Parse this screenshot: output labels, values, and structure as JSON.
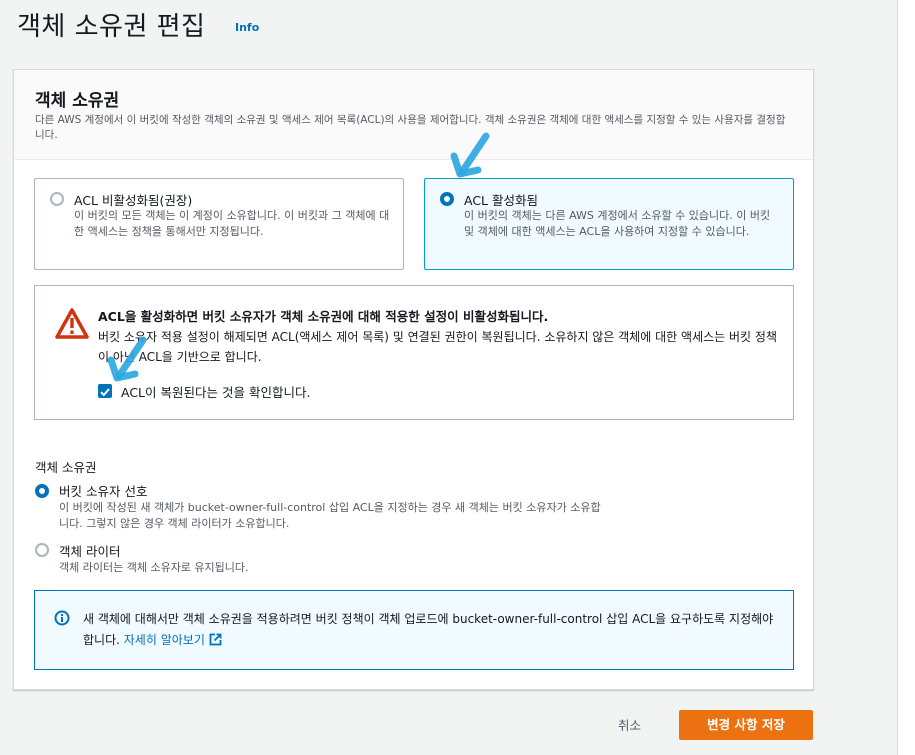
{
  "page": {
    "title": "객체 소유권 편집",
    "info_link": "Info"
  },
  "panel": {
    "title": "객체 소유권",
    "description": "다른 AWS 계정에서 이 버킷에 작성한 객체의 소유권 및 액세스 제어 목록(ACL)의 사용을 제어합니다. 객체 소유권은 객체에 대한 액세스를 지정할 수 있는 사용자를 결정합니다."
  },
  "tiles": [
    {
      "label": "ACL 비활성화됨(권장)",
      "description": "이 버킷의 모든 객체는 이 계정이 소유합니다. 이 버킷과 그 객체에 대한 액세스는 정책을 통해서만 지정됩니다.",
      "selected": false
    },
    {
      "label": "ACL 활성화됨",
      "description": "이 버킷의 객체는 다른 AWS 계정에서 소유할 수 있습니다. 이 버킷 및 객체에 대한 액세스는 ACL을 사용하여 지정할 수 있습니다.",
      "selected": true
    }
  ],
  "warning": {
    "title": "ACL을 활성화하면 버킷 소유자가 객체 소유권에 대해 적용한 설정이 비활성화됩니다.",
    "body": "버킷 소유자 적용 설정이 해제되면 ACL(액세스 제어 목록) 및 연결된 권한이 복원됩니다. 소유하지 않은 객체에 대한 액세스는 버킷 정책이 아닌 ACL을 기반으로 합니다.",
    "checkbox_label": "ACL이 복원된다는 것을 확인합니다.",
    "checkbox_checked": true
  },
  "ownership": {
    "label": "객체 소유권",
    "options": [
      {
        "label": "버킷 소유자 선호",
        "description": "이 버킷에 작성된 새 객체가 bucket-owner-full-control 삽입 ACL을 지정하는 경우 새 객체는 버킷 소유자가 소유합니다. 그렇지 않은 경우 객체 라이터가 소유합니다.",
        "selected": true
      },
      {
        "label": "객체 라이터",
        "description": "객체 라이터는 객체 소유자로 유지됩니다.",
        "selected": false
      }
    ]
  },
  "info_alert": {
    "text": "새 객체에 대해서만 객체 소유권을 적용하려면 버킷 정책이 객체 업로드에 bucket-owner-full-control 삽입 ACL을 요구하도록 지정해야 합니다.",
    "link": "자세히 알아보기"
  },
  "footer": {
    "cancel": "취소",
    "save": "변경 사항 저장"
  },
  "colors": {
    "accent": "#0073bb",
    "primary_button": "#ec7211",
    "warning": "#d13212",
    "annotation": "#2aa6e0"
  }
}
